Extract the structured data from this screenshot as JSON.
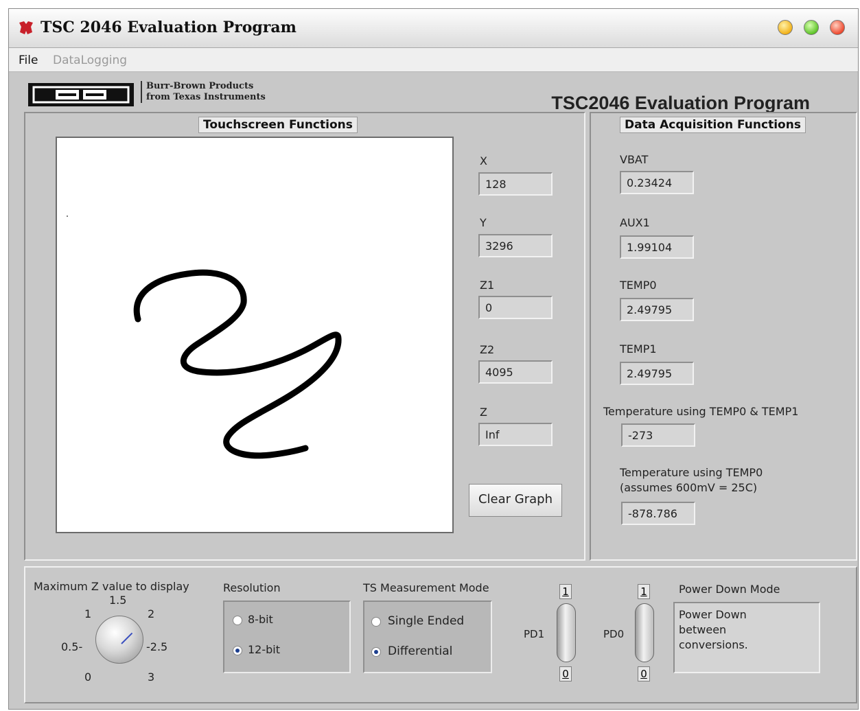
{
  "window": {
    "title": "TSC 2046 Evaluation Program"
  },
  "menu": {
    "file": "File",
    "datalogging": "DataLogging"
  },
  "header": {
    "brand_line1": "Burr-Brown Products",
    "brand_line2": "from Texas Instruments",
    "program_title": "TSC2046 Evaluation Program"
  },
  "touchscreen": {
    "title": "Touchscreen Functions",
    "fields": [
      {
        "label": "X",
        "value": "128"
      },
      {
        "label": "Y",
        "value": "3296"
      },
      {
        "label": "Z1",
        "value": "0"
      },
      {
        "label": "Z2",
        "value": "4095"
      },
      {
        "label": "Z",
        "value": "Inf"
      }
    ],
    "clear_button": "Clear Graph"
  },
  "data_acquisition": {
    "title": "Data Acquisition Functions",
    "fields": [
      {
        "label": "VBAT",
        "value": "0.23424"
      },
      {
        "label": "AUX1",
        "value": "1.99104"
      },
      {
        "label": "TEMP0",
        "value": "2.49795"
      },
      {
        "label": "TEMP1",
        "value": "2.49795"
      }
    ],
    "temp_both_label": "Temperature using TEMP0 & TEMP1",
    "temp_both_value": "-273",
    "temp0_label_1": "Temperature using TEMP0",
    "temp0_label_2": "(assumes 600mV = 25C)",
    "temp0_value": "-878.786"
  },
  "bottom": {
    "maxz_label": "Maximum Z value to display",
    "knob_ticks": [
      "0",
      "0.5",
      "1",
      "1.5",
      "2",
      "2.5",
      "3"
    ],
    "knob_tick_labels": {
      "t0": "0",
      "t05": "0.5-",
      "t1": "1",
      "t15": "1.5",
      "t2": "2",
      "t25": "-2.5",
      "t3": "3"
    },
    "resolution_label": "Resolution",
    "resolution_options": [
      "8-bit",
      "12-bit"
    ],
    "resolution_selected": "12-bit",
    "ts_mode_label": "TS Measurement Mode",
    "ts_mode_options": [
      "Single Ended",
      "Differential"
    ],
    "ts_mode_selected": "Differential",
    "pd1_label": "PD1",
    "pd0_label": "PD0",
    "pd_on": "1",
    "pd_off": "0",
    "power_down_label": "Power Down Mode",
    "power_down_text": "Power Down between conversions."
  }
}
